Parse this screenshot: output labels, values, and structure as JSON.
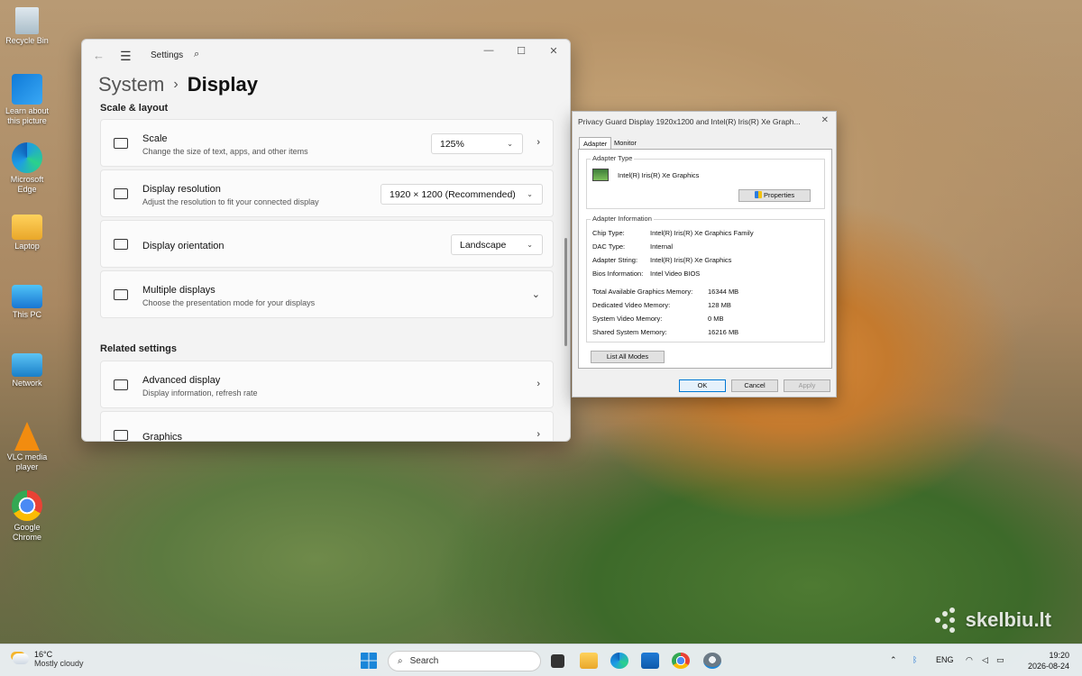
{
  "desktop": {
    "icons": [
      {
        "label": "Recycle Bin"
      },
      {
        "label": "Learn about this picture"
      },
      {
        "label": "Microsoft Edge"
      },
      {
        "label": "Laptop"
      },
      {
        "label": "This PC"
      },
      {
        "label": "Network"
      },
      {
        "label": "VLC media player"
      },
      {
        "label": "Google Chrome"
      }
    ],
    "watermark": "skelbiu.lt"
  },
  "settings": {
    "app_title": "Settings",
    "breadcrumb_parent": "System",
    "breadcrumb_sep": "›",
    "page_title": "Display",
    "section_scale": "Scale & layout",
    "scale": {
      "title": "Scale",
      "subtitle": "Change the size of text, apps, and other items",
      "value": "125%"
    },
    "resolution": {
      "title": "Display resolution",
      "subtitle": "Adjust the resolution to fit your connected display",
      "value": "1920 × 1200 (Recommended)"
    },
    "orientation": {
      "title": "Display orientation",
      "value": "Landscape"
    },
    "multiple": {
      "title": "Multiple displays",
      "subtitle": "Choose the presentation mode for your displays"
    },
    "section_related": "Related settings",
    "advanced": {
      "title": "Advanced display",
      "subtitle": "Display information, refresh rate"
    },
    "graphics": {
      "title": "Graphics"
    }
  },
  "dialog": {
    "title": "Privacy Guard Display 1920x1200 and Intel(R) Iris(R) Xe Graph...",
    "tabs": [
      "Adapter",
      "Monitor"
    ],
    "adapter_type_label": "Adapter Type",
    "adapter_name": "Intel(R) Iris(R) Xe Graphics",
    "properties_btn": "Properties",
    "adapter_info_label": "Adapter Information",
    "info": [
      {
        "key": "Chip Type:",
        "value": "Intel(R) Iris(R) Xe Graphics Family"
      },
      {
        "key": "DAC Type:",
        "value": "Internal"
      },
      {
        "key": "Adapter String:",
        "value": "Intel(R) Iris(R) Xe Graphics"
      },
      {
        "key": "Bios Information:",
        "value": "Intel Video BIOS"
      }
    ],
    "memory": [
      {
        "key": "Total Available Graphics Memory:",
        "value": "16344 MB"
      },
      {
        "key": "Dedicated Video Memory:",
        "value": "128 MB"
      },
      {
        "key": "System Video Memory:",
        "value": "0 MB"
      },
      {
        "key": "Shared System Memory:",
        "value": "16216 MB"
      }
    ],
    "list_modes_btn": "List All Modes",
    "ok_btn": "OK",
    "cancel_btn": "Cancel",
    "apply_btn": "Apply"
  },
  "taskbar": {
    "weather_temp": "16°C",
    "weather_desc": "Mostly cloudy",
    "search_placeholder": "Search",
    "language": "ENG",
    "time": "19:20",
    "date": "2026-08-24"
  },
  "colors": {
    "accent": "#0078d4"
  }
}
